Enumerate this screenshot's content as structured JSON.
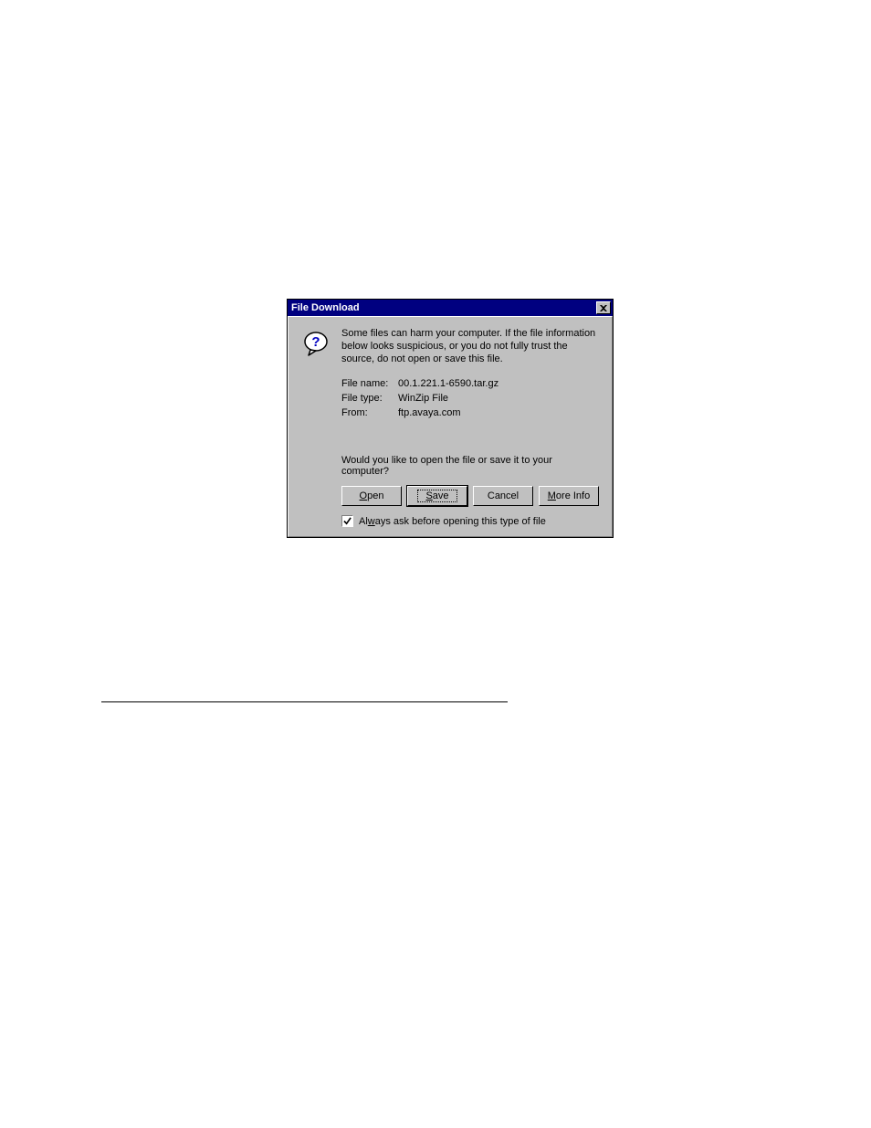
{
  "dialog": {
    "title": "File Download",
    "message": "Some files can harm your computer. If the file information below looks suspicious, or you do not fully trust the source, do not open or save this file.",
    "file_name_label": "File name:",
    "file_name_value": "00.1.221.1-6590.tar.gz",
    "file_type_label": "File type:",
    "file_type_value": "WinZip File",
    "from_label": "From:",
    "from_value": "ftp.avaya.com",
    "prompt": "Would you like to open the file or save it to your computer?",
    "buttons": {
      "open": "Open",
      "save": "Save",
      "cancel": "Cancel",
      "more_info": "More Info"
    },
    "checkbox_label": "Always ask before opening this type of file",
    "checkbox_checked": true
  }
}
